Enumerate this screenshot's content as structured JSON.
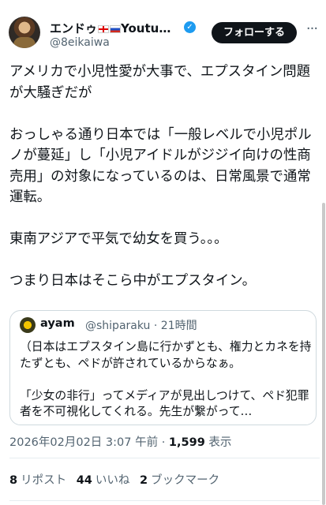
{
  "author": {
    "display_name": "エンドゥ",
    "display_name_suffix": "Youtu…",
    "handle": "@8eikaiwa",
    "verified_badge": "verified-icon",
    "flags": [
      "georgia-flag",
      "russia-flag"
    ]
  },
  "follow_button_label": "フォローする",
  "more_icon": "more-icon",
  "tweet": {
    "paragraphs": [
      "アメリカで小児性愛が大事で、エプスタイン問題が大騒ぎだが",
      "おっしゃる通り日本では「一般レベルで小児ポルノが蔓延」し「小児アイドルがジジイ向けの性商売用」の対象になっているのは、日常風景で通常運転。",
      "東南アジアで平気で幼女を買う。。。",
      "つまり日本はそこら中がエプスタイン。"
    ]
  },
  "quote": {
    "name": "ayam",
    "handle": "@shiparaku",
    "separator": "·",
    "time": "21時間",
    "paragraphs": [
      "（日本はエプスタイン島に行かずとも、権力とカネを持たずとも、ペドが許されているからなぁ。",
      "「少女の非行」ってメディアが見出しつけて、ペド犯罪者を不可視化してくれる。先生が繋がって…"
    ]
  },
  "meta": {
    "timestamp": "2026年02月02日 3:07 午前",
    "separator": "·",
    "views_count": "1,599",
    "views_label": "表示"
  },
  "stats": {
    "reposts_count": "8",
    "reposts_label": "リポスト",
    "likes_count": "44",
    "likes_label": "いいね",
    "bookmarks_count": "2",
    "bookmarks_label": "ブックマーク"
  }
}
